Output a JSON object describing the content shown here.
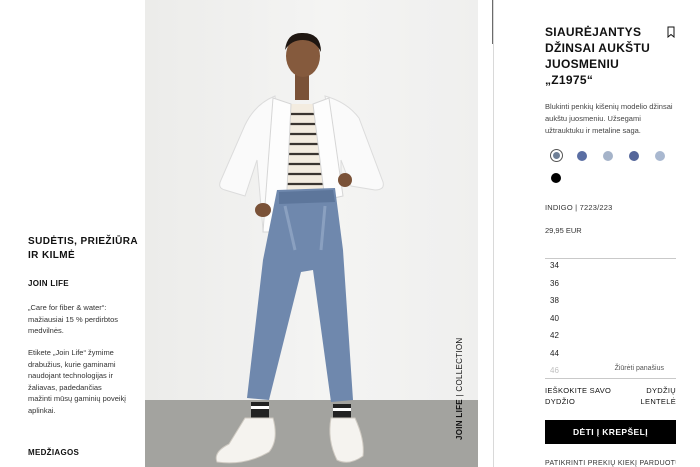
{
  "left_panel": {
    "section_title": "SUDĖTIS, PRIEŽIŪRA IR KILMĖ",
    "join_life_title": "JOIN LIFE",
    "join_life_paragraph_1": "„Care for fiber & water“: mažiausiai 15 % perdirbtos medvilnės.",
    "join_life_paragraph_2": "Etikete „Join Life“ žymime drabužius, kurie gaminami naudojant technologijas ir žaliavas, padedančias mažinti mūsų gaminių poveikį aplinkai.",
    "materials_title": "MEDŽIAGOS"
  },
  "photo": {
    "vertical_label_bold": "JOIN LIFE",
    "vertical_label_rest": " | COLLECTION"
  },
  "product": {
    "title": "SIAURĖJANTYS DŽINSAI AUKŠTU JUOSMENIU „Z1975“",
    "description": "Blukinti penkių kišenių modelio džinsai aukštu juosmeniu. Užsegami užtrauktuku ir metaline saga.",
    "color_line": "INDIGO | 7223/223",
    "price": "29,95 EUR",
    "swatch_colors": [
      "#6f7f96",
      "#5a6ea3",
      "#a5b3c9",
      "#55669a",
      "#a9b8d0",
      "#000000"
    ],
    "selected_swatch": 0,
    "sizes": [
      "34",
      "36",
      "38",
      "40",
      "42",
      "44",
      "46"
    ],
    "similar_label": "Žiūrėti panašius",
    "find_size_label": "IEŠKOKITE SAVO DYDŽIO",
    "size_chart_label": "DYDŽIŲ LENTELĖ",
    "add_to_cart_label": "DĖTI Į KREPŠELĮ",
    "check_stock_label": "PATIKRINTI PREKIŲ KIEKĮ PARDUOTUVĖSE"
  },
  "icons": {
    "bookmark": "bookmark-icon"
  }
}
